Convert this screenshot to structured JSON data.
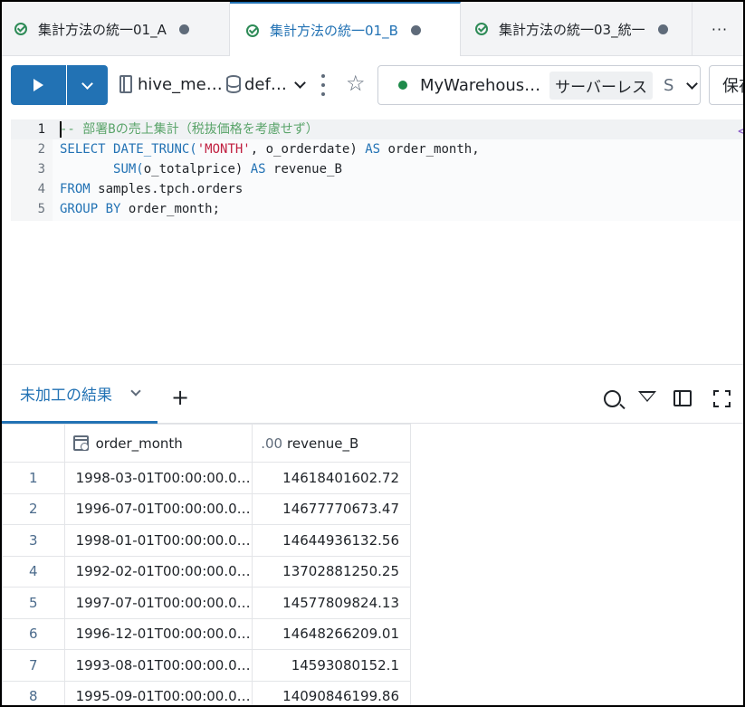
{
  "tabs": [
    {
      "label": "集計方法の統一01_A",
      "active": false
    },
    {
      "label": "集計方法の統一01_B",
      "active": true
    },
    {
      "label": "集計方法の統一03_統一",
      "active": false
    }
  ],
  "tab_overflow": "···",
  "toolbar": {
    "catalog": "hive_me…",
    "schema": "def…",
    "warehouse_name": "MyWarehous…",
    "warehouse_type": "サーバーレス",
    "warehouse_size": "S",
    "save_label": "保存",
    "accent": "#2272b4",
    "status_color": "#1e8a4a"
  },
  "editor": {
    "line_numbers": [
      "1",
      "2",
      "3",
      "4",
      "5"
    ],
    "lines": [
      "-- 部署Bの売上集計（税抜価格を考慮せず）",
      "SELECT DATE_TRUNC('MONTH', o_orderdate) AS order_month,",
      "       SUM(o_totalprice) AS revenue_B",
      "FROM samples.tpch.orders",
      "GROUP BY order_month;"
    ],
    "tokens": {
      "l1": "-- 部署Bの売上集計（税抜価格を考慮せず）",
      "l2_kw1": "SELECT",
      "l2_fn": "DATE_TRUNC(",
      "l2_str": "'MONTH'",
      "l2_mid": ", o_orderdate) ",
      "l2_kw2": "AS",
      "l2_end": " order_month,",
      "l3_indent": "       ",
      "l3_fn": "SUM(",
      "l3_mid": "o_totalprice) ",
      "l3_kw": "AS",
      "l3_end": " revenue_B",
      "l4_kw": "FROM",
      "l4_end": " samples.tpch.orders",
      "l5_kw": "GROUP BY",
      "l5_end": " order_month;"
    },
    "right_marker": "<"
  },
  "results": {
    "tab_label": "未加工の結果",
    "columns": [
      {
        "name": "order_month",
        "type_icon": "calendar-clock-icon"
      },
      {
        "name": "revenue_B",
        "type_label": ".00"
      }
    ],
    "rows": [
      {
        "idx": "1",
        "order_month": "1998-03-01T00:00:00.0…",
        "revenue_B": "14618401602.72"
      },
      {
        "idx": "2",
        "order_month": "1996-07-01T00:00:00.0…",
        "revenue_B": "14677770673.47"
      },
      {
        "idx": "3",
        "order_month": "1998-01-01T00:00:00.0…",
        "revenue_B": "14644936132.56"
      },
      {
        "idx": "4",
        "order_month": "1992-02-01T00:00:00.0…",
        "revenue_B": "13702881250.25"
      },
      {
        "idx": "5",
        "order_month": "1997-07-01T00:00:00.0…",
        "revenue_B": "14577809824.13"
      },
      {
        "idx": "6",
        "order_month": "1996-12-01T00:00:00.0…",
        "revenue_B": "14648266209.01"
      },
      {
        "idx": "7",
        "order_month": "1993-08-01T00:00:00.0…",
        "revenue_B": "14593080152.1"
      },
      {
        "idx": "8",
        "order_month": "1995-09-01T00:00:00.0…",
        "revenue_B": "14090846199.86"
      }
    ]
  }
}
